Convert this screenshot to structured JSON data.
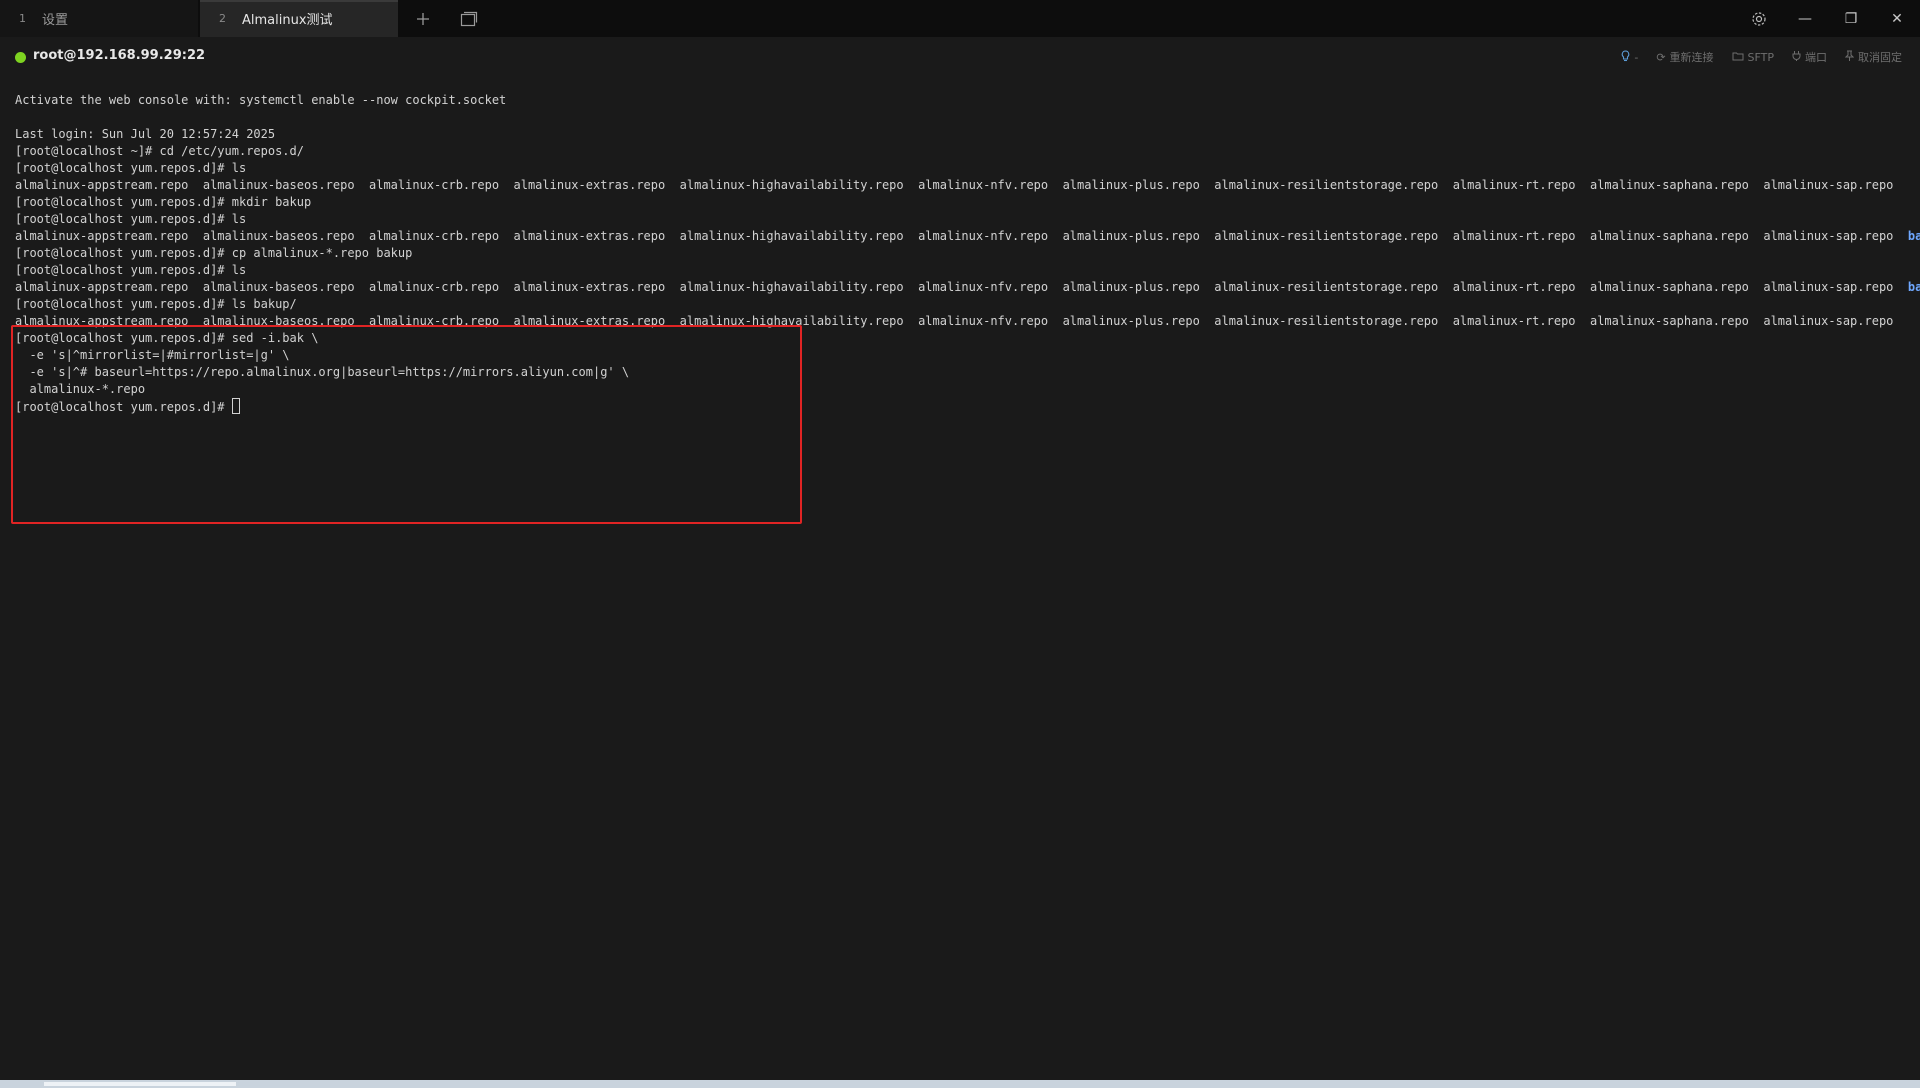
{
  "tabs": [
    {
      "num": "1",
      "label": "设置"
    },
    {
      "num": "2",
      "label": "Almalinux测试"
    }
  ],
  "tab_actions": {
    "new_tab_icon": "plus-icon",
    "tab_list_icon": "window-stack-icon"
  },
  "window_controls": {
    "settings_icon": "gear-icon",
    "minimize": "—",
    "restore": "❐",
    "close": "✕"
  },
  "session": {
    "status_color": "#7ed321",
    "host": "root@192.168.99.29:22"
  },
  "toolbar": {
    "hint_icon": "lightbulb-icon",
    "hint_suffix": "-",
    "reconnect": "重新连接",
    "sftp": "SFTP",
    "port": "端口",
    "unpin": "取消固定"
  },
  "terminal": {
    "lines": [
      "Activate the web console with: systemctl enable --now cockpit.socket",
      "",
      "Last login: Sun Jul 20 12:57:24 2025",
      "[root@localhost ~]# cd /etc/yum.repos.d/",
      "[root@localhost yum.repos.d]# ls",
      "almalinux-appstream.repo  almalinux-baseos.repo  almalinux-crb.repo  almalinux-extras.repo  almalinux-highavailability.repo  almalinux-nfv.repo  almalinux-plus.repo  almalinux-resilientstorage.repo  almalinux-rt.repo  almalinux-saphana.repo  almalinux-sap.repo",
      "[root@localhost yum.repos.d]# mkdir bakup",
      "[root@localhost yum.repos.d]# ls",
      "almalinux-appstream.repo  almalinux-baseos.repo  almalinux-crb.repo  almalinux-extras.repo  almalinux-highavailability.repo  almalinux-nfv.repo  almalinux-plus.repo  almalinux-resilientstorage.repo  almalinux-rt.repo  almalinux-saphana.repo  almalinux-sap.repo  ",
      "[root@localhost yum.repos.d]# cp almalinux-*.repo bakup",
      "[root@localhost yum.repos.d]# ls",
      "almalinux-appstream.repo  almalinux-baseos.repo  almalinux-crb.repo  almalinux-extras.repo  almalinux-highavailability.repo  almalinux-nfv.repo  almalinux-plus.repo  almalinux-resilientstorage.repo  almalinux-rt.repo  almalinux-saphana.repo  almalinux-sap.repo  ",
      "[root@localhost yum.repos.d]# ls bakup/",
      "almalinux-appstream.repo  almalinux-baseos.repo  almalinux-crb.repo  almalinux-extras.repo  almalinux-highavailability.repo  almalinux-nfv.repo  almalinux-plus.repo  almalinux-resilientstorage.repo  almalinux-rt.repo  almalinux-saphana.repo  almalinux-sap.repo",
      "[root@localhost yum.repos.d]# sed -i.bak \\",
      "  -e 's|^mirrorlist=|#mirrorlist=|g' \\",
      "  -e 's|^# baseurl=https://repo.almalinux.org|baseurl=https://mirrors.aliyun.com|g' \\",
      "  almalinux-*.repo"
    ],
    "dir_name": "bakup",
    "prompt": "[root@localhost yum.repos.d]# ",
    "dir_color": "#6fa8ff",
    "highlight_color": "#e02424"
  }
}
